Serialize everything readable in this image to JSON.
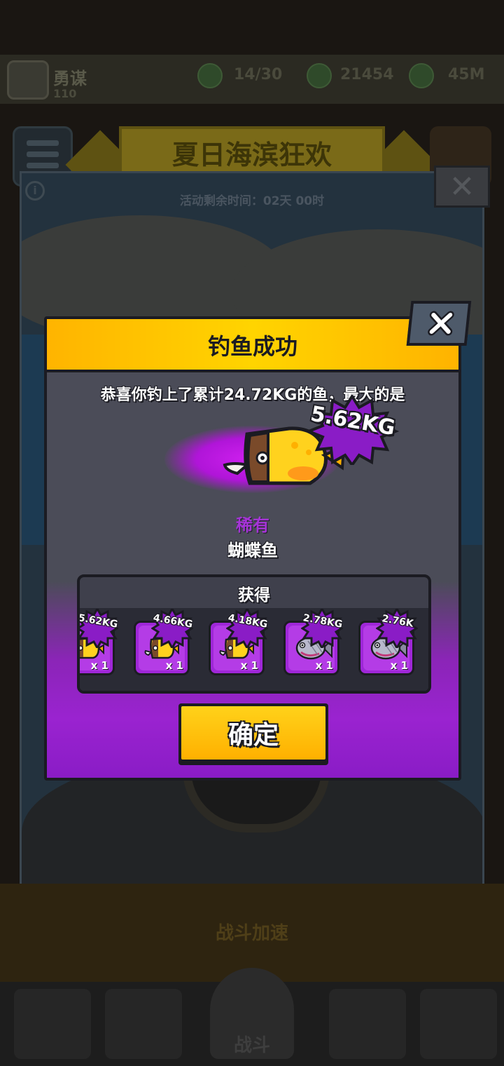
{
  "background": {
    "player": {
      "name": "勇谋",
      "level": "110"
    },
    "resources": [
      {
        "icon": "energy-icon",
        "value": "14/30"
      },
      {
        "icon": "gem-icon",
        "value": "21454"
      },
      {
        "icon": "coin-icon",
        "value": "45M"
      }
    ],
    "event_title": "夏日海滨狂欢",
    "event_timer": "活动剩余时间：02天 00时",
    "speed_label": "战斗加速",
    "nav_battle_label": "战斗"
  },
  "modal": {
    "title": "钓鱼成功",
    "congrats_text": "恭喜你钓上了累计24.72KG的鱼，最大的是",
    "biggest_weight": "5.62KG",
    "rarity": "稀有",
    "fish_name": "蝴蝶鱼",
    "rewards_title": "获得",
    "rewards": [
      {
        "weight": "5.62KG",
        "qty": "x 1",
        "icon": "butterflyfish-icon"
      },
      {
        "weight": "4.66KG",
        "qty": "x 1",
        "icon": "butterflyfish-icon"
      },
      {
        "weight": "4.18KG",
        "qty": "x 1",
        "icon": "butterflyfish-icon"
      },
      {
        "weight": "2.78KG",
        "qty": "x 1",
        "icon": "piranha-icon"
      },
      {
        "weight": "2.76K",
        "qty": "x 1",
        "icon": "piranha-icon"
      }
    ],
    "confirm_label": "确定"
  },
  "colors": {
    "header_yellow": "#ffd400",
    "rare_purple": "#a534d6",
    "slot_purple": "#b43ce6",
    "modal_body": "#4b4c58",
    "outline": "#1b1b22"
  }
}
